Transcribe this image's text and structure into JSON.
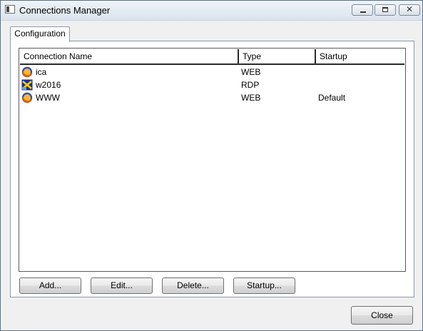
{
  "window": {
    "title": "Connections Manager",
    "controls": {
      "minimize": "minimize-icon",
      "maximize": "maximize-icon",
      "close": "close-icon",
      "close_glyph": "✕"
    }
  },
  "tabs": [
    {
      "label": "Configuration",
      "active": true
    }
  ],
  "list": {
    "columns": [
      "Connection Name",
      "Type",
      "Startup"
    ],
    "rows": [
      {
        "name": "ica",
        "type": "WEB",
        "startup": "",
        "icon": "firefox-icon"
      },
      {
        "name": "w2016",
        "type": "RDP",
        "startup": "",
        "icon": "rdp-icon"
      },
      {
        "name": "WWW",
        "type": "WEB",
        "startup": "Default",
        "icon": "firefox-icon"
      }
    ]
  },
  "buttons": {
    "add": "Add...",
    "edit": "Edit...",
    "delete": "Delete...",
    "startup": "Startup...",
    "close": "Close"
  }
}
